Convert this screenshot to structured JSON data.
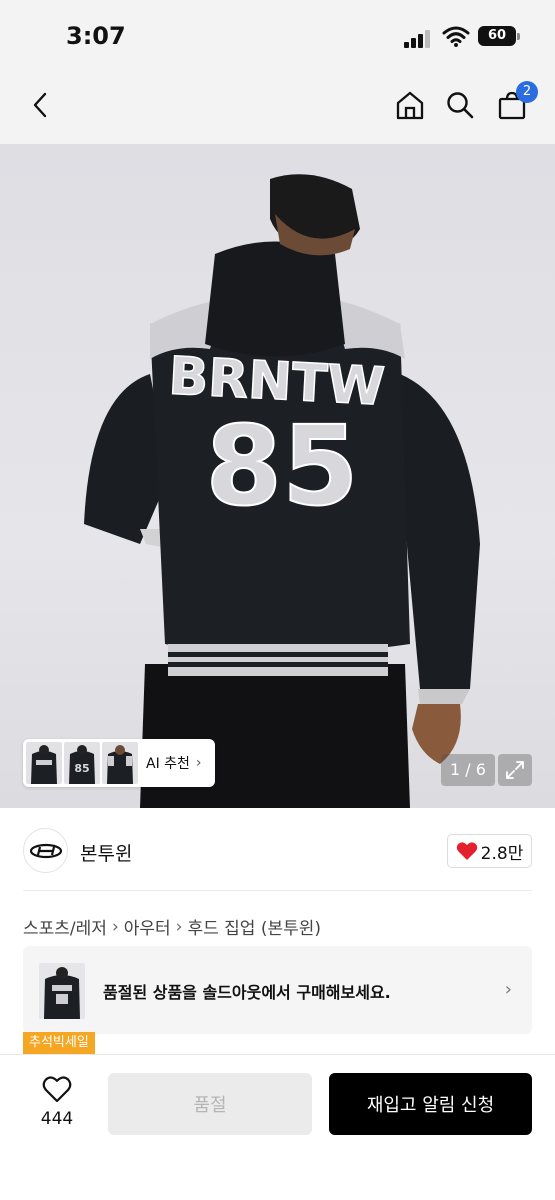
{
  "status_bar": {
    "time": "3:07",
    "battery": "60"
  },
  "header": {
    "cart_count": "2"
  },
  "gallery": {
    "image_text_top": "BRNTW",
    "image_text_number": "85",
    "thumb_text": "85",
    "ai_label": "AI 추천",
    "page_indicator": "1 / 6"
  },
  "brand": {
    "name": "본투윈",
    "likes": "2.8만"
  },
  "breadcrumb": [
    "스포츠/레저",
    "아우터",
    "후드 집업 (본투윈)"
  ],
  "sold_banner": {
    "text": "품절된 상품을 솔드아웃에서 구매해보세요."
  },
  "promo_badge": "추석빅세일",
  "bottom": {
    "wish_count": "444",
    "soldout_label": "품절",
    "restock_label": "재입고 알림 신청"
  },
  "colors": {
    "accent": "#2b6cdf",
    "heart": "#e5202e",
    "badge": "#f5a623"
  }
}
